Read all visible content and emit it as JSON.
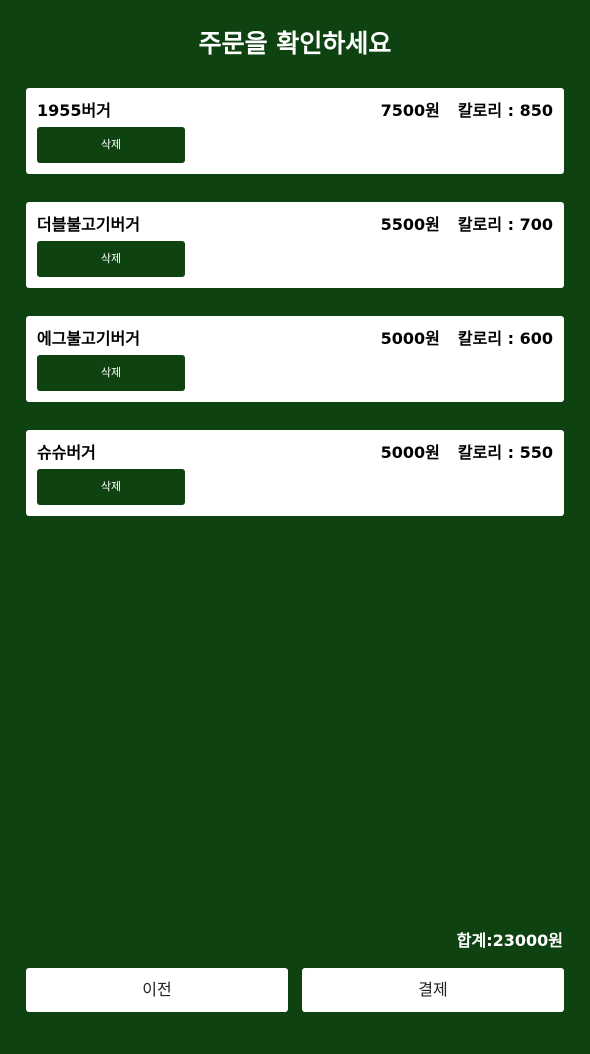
{
  "header": {
    "title": "주문을 확인하세요"
  },
  "order_items": [
    {
      "name": "1955버거",
      "price": "7500원",
      "calorie": "칼로리 : 850",
      "delete_label": "삭제"
    },
    {
      "name": "더블불고기버거",
      "price": "5500원",
      "calorie": "칼로리 : 700",
      "delete_label": "삭제"
    },
    {
      "name": "에그불고기버거",
      "price": "5000원",
      "calorie": "칼로리 : 600",
      "delete_label": "삭제"
    },
    {
      "name": "슈슈버거",
      "price": "5000원",
      "calorie": "칼로리 : 550",
      "delete_label": "삭제"
    }
  ],
  "summary": {
    "total": "합계:23000원"
  },
  "footer": {
    "prev_label": "이전",
    "pay_label": "결제"
  },
  "colors": {
    "background": "#0f4211",
    "card": "#ffffff",
    "button": "#0f4211"
  }
}
